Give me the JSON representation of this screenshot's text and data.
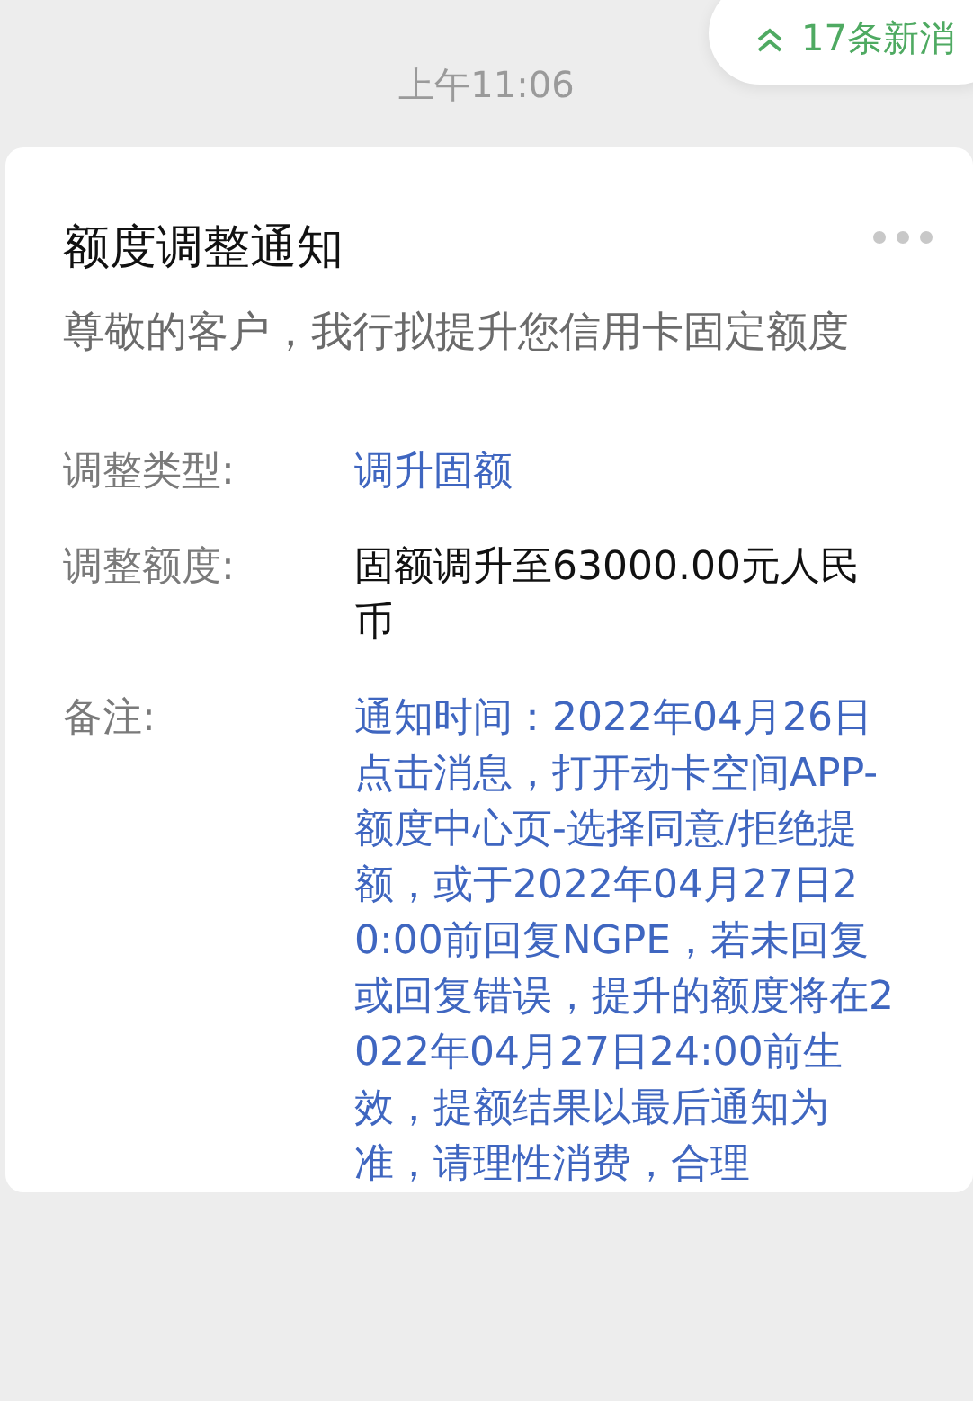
{
  "new_messages": {
    "label": "17条新消"
  },
  "timestamp": "上午11:06",
  "card": {
    "title": "额度调整通知",
    "subtitle": "尊敬的客户，我行拟提升您信用卡固定额度",
    "fields": [
      {
        "label": "调整类型:",
        "value": "调升固额",
        "kind": "link"
      },
      {
        "label": "调整额度:",
        "value": "固额调升至63000.00元人民币",
        "kind": "plain"
      },
      {
        "label": "备注:",
        "value": "通知时间：2022年04月26日点击消息，打开动卡空间APP-额度中心页-选择同意/拒绝提额，或于2022年04月27日20:00前回复NGPE，若未回复或回复错误，提升的额度将在2022年04月27日24:00前生效，提额结果以最后通知为准，请理性消费，合理",
        "kind": "link"
      }
    ]
  }
}
